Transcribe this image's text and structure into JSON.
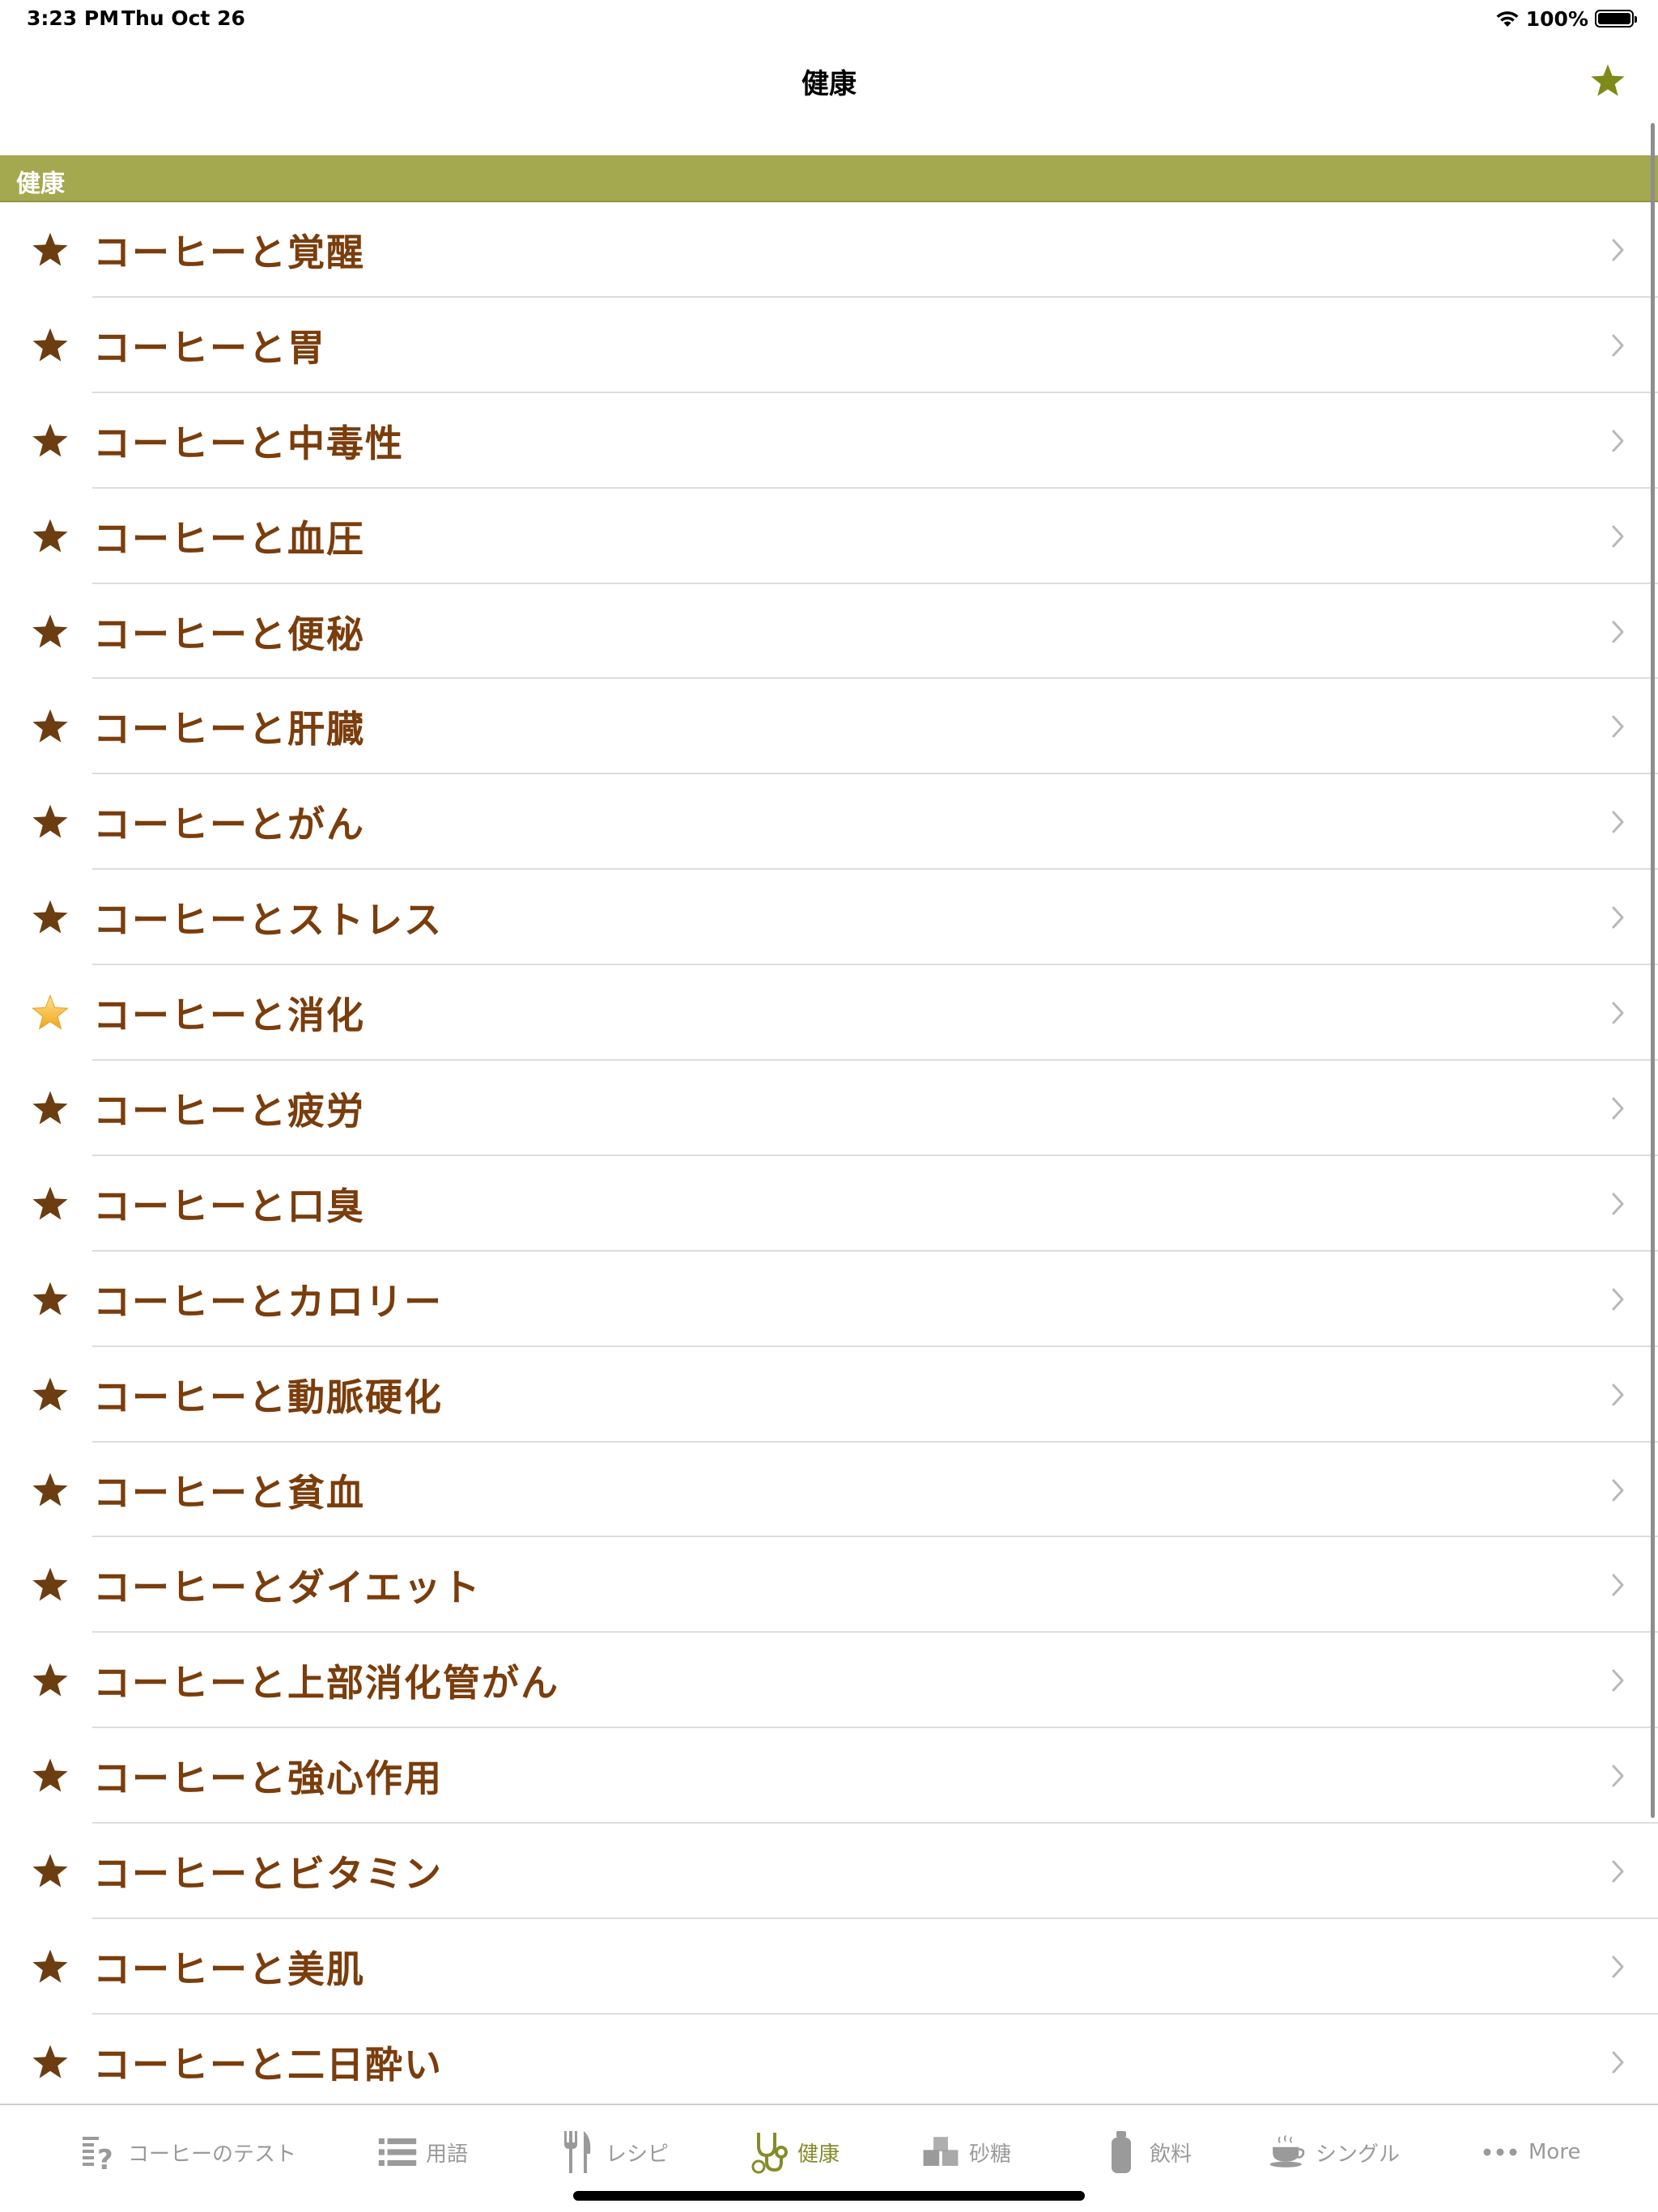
{
  "status_bar": {
    "time": "3:23 PM",
    "date": "Thu Oct 26",
    "battery": "100%"
  },
  "nav": {
    "title": "健康"
  },
  "section": {
    "title": "健康"
  },
  "colors": {
    "accent": "#a4a84f",
    "row_text": "#7a3d0c",
    "star_brown": "#6b3d10",
    "star_gold": "#f3b82c",
    "tab_active": "#858c2a",
    "tab_inactive": "#9a9a9a"
  },
  "items": [
    {
      "label": "コーヒーと覚醒",
      "icon": "star-brown-icon"
    },
    {
      "label": "コーヒーと胃",
      "icon": "star-brown-icon"
    },
    {
      "label": "コーヒーと中毒性",
      "icon": "star-brown-icon"
    },
    {
      "label": "コーヒーと血圧",
      "icon": "star-brown-icon"
    },
    {
      "label": "コーヒーと便秘",
      "icon": "star-brown-icon"
    },
    {
      "label": "コーヒーと肝臓",
      "icon": "star-brown-icon"
    },
    {
      "label": "コーヒーとがん",
      "icon": "star-brown-icon"
    },
    {
      "label": "コーヒーとストレス",
      "icon": "star-brown-icon"
    },
    {
      "label": "コーヒーと消化",
      "icon": "star-gold-icon"
    },
    {
      "label": "コーヒーと疲労",
      "icon": "star-brown-icon"
    },
    {
      "label": "コーヒーと口臭",
      "icon": "star-brown-icon"
    },
    {
      "label": "コーヒーとカロリー",
      "icon": "star-brown-icon"
    },
    {
      "label": "コーヒーと動脈硬化",
      "icon": "star-brown-icon"
    },
    {
      "label": "コーヒーと貧血",
      "icon": "star-brown-icon"
    },
    {
      "label": "コーヒーとダイエット",
      "icon": "star-brown-icon"
    },
    {
      "label": "コーヒーと上部消化管がん",
      "icon": "star-brown-icon"
    },
    {
      "label": "コーヒーと強心作用",
      "icon": "star-brown-icon"
    },
    {
      "label": "コーヒーとビタミン",
      "icon": "star-brown-icon"
    },
    {
      "label": "コーヒーと美肌",
      "icon": "star-brown-icon"
    },
    {
      "label": "コーヒーと二日酔い",
      "icon": "star-brown-icon"
    }
  ],
  "tabs": [
    {
      "label": "コーヒーのテスト",
      "icon": "quiz-list-icon",
      "active": false
    },
    {
      "label": "用語",
      "icon": "list-icon",
      "active": false
    },
    {
      "label": "レシピ",
      "icon": "fork-knife-icon",
      "active": false
    },
    {
      "label": "健康",
      "icon": "stethoscope-icon",
      "active": true
    },
    {
      "label": "砂糖",
      "icon": "sugar-cubes-icon",
      "active": false
    },
    {
      "label": "飲料",
      "icon": "bottle-icon",
      "active": false
    },
    {
      "label": "シングル",
      "icon": "coffee-cup-icon",
      "active": false
    },
    {
      "label": "More",
      "icon": "more-dots-icon",
      "active": false
    }
  ]
}
